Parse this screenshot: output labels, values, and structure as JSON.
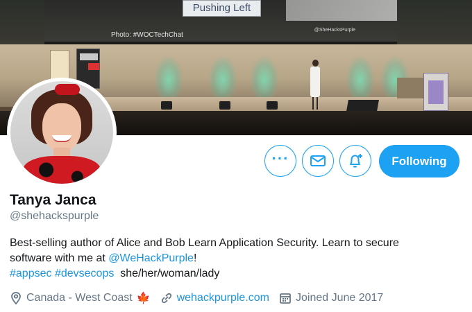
{
  "banner": {
    "slide_text": "Pushing Left",
    "photo_credit": "Photo: #WOCTechChat",
    "slide_handle": "@SheHacksPurple"
  },
  "actions": {
    "more_icon": "more-horizontal-icon",
    "message_icon": "envelope-icon",
    "notifications_icon": "bell-plus-icon",
    "follow_label": "Following"
  },
  "profile": {
    "name": "Tanya Janca",
    "handle": "@shehackspurple",
    "bio": {
      "line1": "Best-selling author of Alice and Bob Learn Application Security. Learn to secure",
      "line2_prefix": "software with me at ",
      "line2_link": "@WeHackPurple",
      "line2_suffix": "!",
      "hashtag1": "#appsec",
      "hashtag2": "#devsecops",
      "pronouns": "she/her/woman/lady"
    },
    "location": "Canada - West Coast",
    "location_emoji": "🍁",
    "website": "wehackpurple.com",
    "joined": "Joined June 2017"
  },
  "colors": {
    "accent": "#1da1f2",
    "link": "#1b95e0",
    "secondary_text": "#657786"
  }
}
